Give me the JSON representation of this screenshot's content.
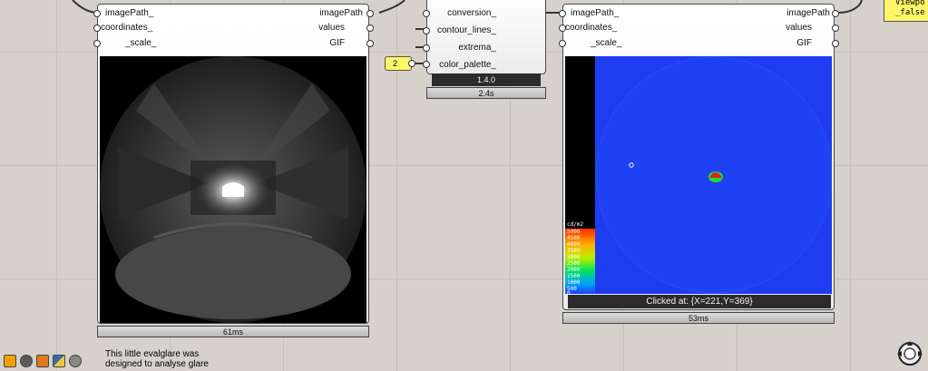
{
  "left_node": {
    "inputs": [
      "imagePath_",
      "coordinates_",
      "_scale_"
    ],
    "outputs": [
      "imagePath",
      "values",
      "GIF"
    ],
    "timer": "61ms"
  },
  "middle_node": {
    "inputs": [
      "conversion_",
      "contour_lines_",
      "extrema_",
      "color_palette_"
    ],
    "version": "1.4.0",
    "timer": "2.4s"
  },
  "number_panel": {
    "value": "2"
  },
  "right_node": {
    "inputs": [
      "imagePath_",
      "coordinates_",
      "_scale_"
    ],
    "outputs": [
      "imagePath",
      "values",
      "GIF"
    ],
    "status": "Clicked at: {X=221,Y=369}",
    "timer": "53ms",
    "legend": {
      "unit": "cd/m2",
      "labels": [
        "5000",
        "4500",
        "4000",
        "3500",
        "3000",
        "2500",
        "2000",
        "1500",
        "1000",
        "500",
        "0"
      ]
    }
  },
  "toggle_panel": {
    "line1": "Viewpo",
    "line2": "_false"
  },
  "note": {
    "line1": "This little evalglare was",
    "line2": "designed to analyse glare"
  },
  "toolbar": [
    "menu-icon",
    "hexagon-icon",
    "paint-icon",
    "python-icon",
    "gear-icon"
  ],
  "colors": {
    "canvas": "#d6d2cb",
    "panel_yellow": "#fff568",
    "falsecolor_blue": "#1e3cf0",
    "hotspot_red": "#e02010"
  }
}
